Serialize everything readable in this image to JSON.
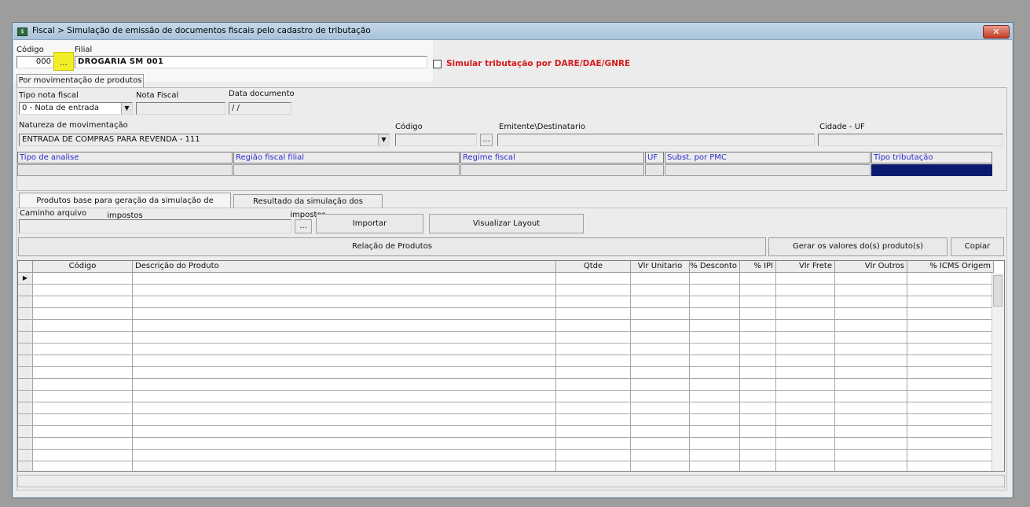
{
  "window": {
    "title": "Fiscal > Simulação de emissão de documentos fiscais pelo cadastro de tributação",
    "close_label": "✕"
  },
  "header": {
    "codigo_label": "Código",
    "codigo_value": "000",
    "lookup_label": "...",
    "filial_label": "Filial",
    "filial_value": "DROGARIA SM 001",
    "simular_label": "Simular tributação por DARE/DAE/GNRE",
    "tab_movimentacao": "Por movimentação de produtos"
  },
  "form": {
    "tipo_nota_label": "Tipo nota fiscal",
    "tipo_nota_value": "0 - Nota de entrada",
    "nota_fiscal_label": "Nota Fiscal",
    "nota_fiscal_value": "",
    "data_documento_label": "Data documento",
    "data_documento_value": " /  /",
    "natureza_label": "Natureza de movimentação",
    "natureza_value": "ENTRADA DE COMPRAS PARA REVENDA - 111",
    "codigo2_label": "Código",
    "codigo2_lookup": "...",
    "emitente_label": "Emitente\\Destinatario",
    "cidade_uf_label": "Cidade - UF"
  },
  "info_bar": {
    "columns": [
      "Tipo de analise",
      "Região fiscal filial",
      "Regime fiscal",
      "UF",
      "Subst. por PMC",
      "Tipo tributação"
    ]
  },
  "tabs": [
    {
      "label": "Produtos base para geração da simulação de impostos"
    },
    {
      "label": "Resultado da simulação dos impostos"
    }
  ],
  "import": {
    "caminho_label": "Caminho arquivo",
    "browse_label": "...",
    "importar_label": "Importar",
    "visualizar_label": "Visualizar Layout"
  },
  "products": {
    "relacao_label": "Relação de Produtos",
    "gerar_label": "Gerar os valores do(s) produto(s)",
    "copiar_label": "Copiar",
    "columns": [
      "Código",
      "Descrição do Produto",
      "Qtde",
      "Vlr Unitario",
      "% Desconto",
      "% IPI",
      "Vlr Frete",
      "Vlr Outros",
      "% ICMS Origem"
    ],
    "row_count": 17
  },
  "colors": {
    "accent_red": "#d71a1a",
    "highlight_yellow": "#f2ef2a",
    "selected_header": "#0a1a6e"
  }
}
